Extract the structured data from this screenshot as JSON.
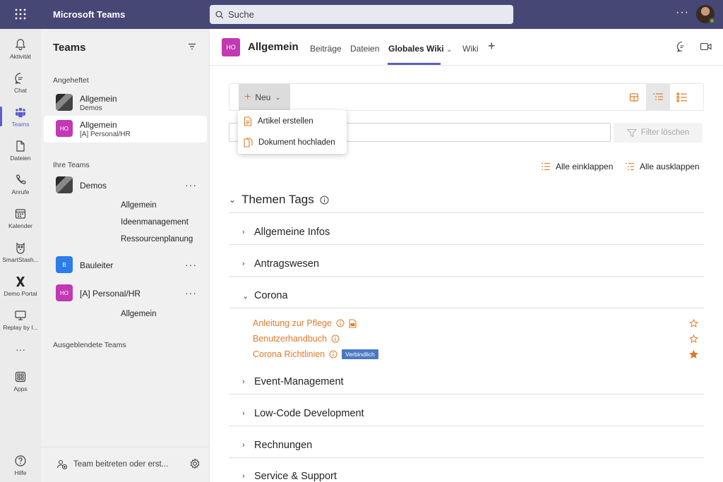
{
  "app": {
    "name": "Microsoft Teams",
    "search_placeholder": "Suche",
    "more": "···"
  },
  "rail": [
    {
      "label": "Aktivität",
      "icon": "bell-icon"
    },
    {
      "label": "Chat",
      "icon": "chat-icon"
    },
    {
      "label": "Teams",
      "icon": "teams-icon",
      "active": true
    },
    {
      "label": "Dateien",
      "icon": "file-icon"
    },
    {
      "label": "Anrufe",
      "icon": "phone-icon"
    },
    {
      "label": "Kalender",
      "icon": "calendar-icon"
    },
    {
      "label": "SmartStash...",
      "icon": "owl-icon"
    },
    {
      "label": "Demo Portal",
      "icon": "x-logo-icon"
    },
    {
      "label": "Replay by I...",
      "icon": "monitor-icon"
    },
    {
      "label": "···",
      "icon": "more-icon"
    },
    {
      "label": "Apps",
      "icon": "apps-icon"
    },
    {
      "label": "Hilfe",
      "icon": "help-icon"
    }
  ],
  "teams_pane": {
    "title": "Teams",
    "pinned_label": "Angeheftet",
    "pinned": [
      {
        "name": "Allgemein",
        "sub": "Demos"
      },
      {
        "name": "Allgemein",
        "sub": "[A] Personal/HR",
        "tile": "HO"
      }
    ],
    "your_teams_label": "Ihre Teams",
    "teams": [
      {
        "name": "Demos",
        "channels": [
          "Allgemein",
          "Ideenmanagement",
          "Ressourcenplanung"
        ]
      },
      {
        "name": "Bauleiter",
        "tile": "B"
      },
      {
        "name": "[A] Personal/HR",
        "tile": "HO",
        "channels": [
          "Allgemein"
        ]
      }
    ],
    "team_more": "···",
    "hidden_label": "Ausgeblendete Teams",
    "join_label": "Team beitreten oder erst..."
  },
  "channel": {
    "tile": "HO",
    "name": "Allgemein",
    "tabs": [
      "Beiträge",
      "Dateien",
      "Globales Wiki",
      "Wiki"
    ],
    "active_tab": "Globales Wiki",
    "tab_chevron": "⌄",
    "add_tab": "+"
  },
  "wiki": {
    "new_label": "Neu",
    "new_plus": "+",
    "new_chevron": "⌄",
    "dropdown": [
      "Artikel erstellen",
      "Dokument hochladen"
    ],
    "filter_clear": "Filter löschen",
    "collapse_all": "Alle einklappen",
    "expand_all": "Alle ausklappen",
    "section_title": "Themen Tags",
    "chevron_open": "⌄",
    "chevron_closed": "›",
    "groups": [
      {
        "name": "Allgemeine Infos"
      },
      {
        "name": "Antragswesen"
      },
      {
        "name": "Corona",
        "expanded": true
      },
      {
        "name": "Event-Management"
      },
      {
        "name": "Low-Code Development"
      },
      {
        "name": "Rechnungen"
      },
      {
        "name": "Service & Support"
      }
    ],
    "articles": [
      {
        "title": "Anleitung zur Pflege",
        "favorite": false
      },
      {
        "title": "Benutzerhandbuch",
        "favorite": false
      },
      {
        "title": "Corona Richtlinien",
        "badge": "Verbindlich",
        "favorite": true
      }
    ],
    "accent": "#e07b2a"
  }
}
